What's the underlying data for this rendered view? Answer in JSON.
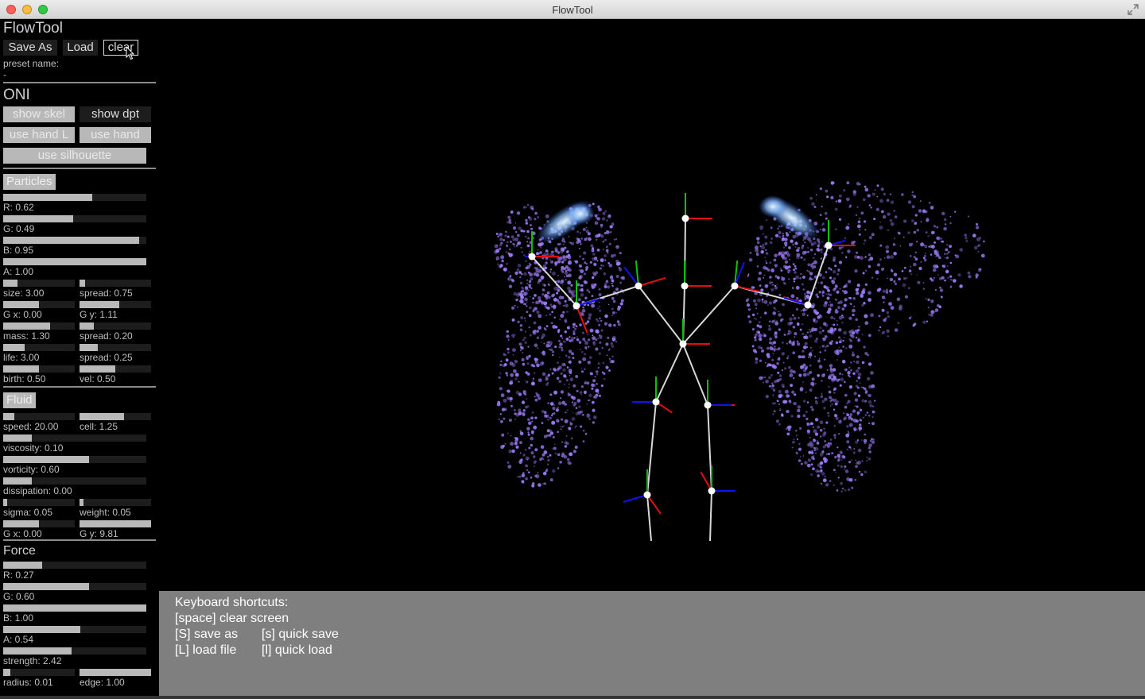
{
  "window": {
    "title": "FlowTool"
  },
  "panel": {
    "title": "FlowTool",
    "buttons": {
      "save_as": "Save As",
      "load": "Load",
      "clear": "clear"
    },
    "preset_label": "preset name:",
    "preset_value": "-",
    "oni": {
      "title": "ONI",
      "show_skel": "show skel",
      "show_dpt": "show dpt",
      "use_hand_l": "use hand L",
      "use_hand_r": "use hand",
      "use_silhouette": "use silhouette"
    },
    "particles": {
      "title": "Particles",
      "sliders": [
        {
          "label": "R: 0.62",
          "fraction": 0.62
        },
        {
          "label": "G: 0.49",
          "fraction": 0.49
        },
        {
          "label": "B: 0.95",
          "fraction": 0.95
        },
        {
          "label": "A: 1.00",
          "fraction": 1.0
        }
      ],
      "pairs": [
        {
          "left": {
            "label": "size: 3.00",
            "fraction": 0.2
          },
          "right": {
            "label": "spread: 0.75",
            "fraction": 0.08
          }
        },
        {
          "left": {
            "label": "G x: 0.00",
            "fraction": 0.5
          },
          "right": {
            "label": "G y: 1.11",
            "fraction": 0.55
          }
        },
        {
          "left": {
            "label": "mass: 1.30",
            "fraction": 0.65
          },
          "right": {
            "label": "spread: 0.20",
            "fraction": 0.2
          }
        },
        {
          "left": {
            "label": "life: 3.00",
            "fraction": 0.3
          },
          "right": {
            "label": "spread: 0.25",
            "fraction": 0.25
          }
        },
        {
          "left": {
            "label": "birth: 0.50",
            "fraction": 0.5
          },
          "right": {
            "label": "vel: 0.50",
            "fraction": 0.5
          }
        }
      ]
    },
    "fluid": {
      "title": "Fluid",
      "speed": {
        "label": "speed: 20.00",
        "fraction": 0.15
      },
      "cell": {
        "label": "cell: 1.25",
        "fraction": 0.62
      },
      "sliders": [
        {
          "label": "viscosity: 0.10",
          "fraction": 0.2
        },
        {
          "label": "vorticity: 0.60",
          "fraction": 0.6
        },
        {
          "label": "dissipation: 0.00",
          "fraction": 0.2
        }
      ],
      "pairs": [
        {
          "left": {
            "label": "sigma: 0.05",
            "fraction": 0.05
          },
          "right": {
            "label": "weight: 0.05",
            "fraction": 0.05
          }
        },
        {
          "left": {
            "label": "G x: 0.00",
            "fraction": 0.5
          },
          "right": {
            "label": "G y: 9.81",
            "fraction": 1.0
          }
        }
      ]
    },
    "force": {
      "title": "Force",
      "sliders": [
        {
          "label": "R: 0.27",
          "fraction": 0.27
        },
        {
          "label": "G: 0.60",
          "fraction": 0.6
        },
        {
          "label": "B: 1.00",
          "fraction": 1.0
        },
        {
          "label": "A: 0.54",
          "fraction": 0.54
        },
        {
          "label": "strength: 2.42",
          "fraction": 0.48
        }
      ],
      "radius": {
        "label": "radius: 0.01",
        "fraction": 0.1
      },
      "edge": {
        "label": "edge: 1.00",
        "fraction": 1.0
      }
    }
  },
  "help": {
    "title": "Keyboard shortcuts:",
    "space": "[space] clear screen",
    "save_as": "[S] save as",
    "quick_save": "[s] quick save",
    "load_file": "[L] load file",
    "quick_load": "[l] quick load"
  },
  "colors": {
    "particle": "#9f7dfc",
    "bone": "#d8d8d8",
    "axis_red": "#e01010",
    "axis_green": "#10c010",
    "axis_blue": "#1010ff",
    "help_bg": "#7f7f7f"
  }
}
